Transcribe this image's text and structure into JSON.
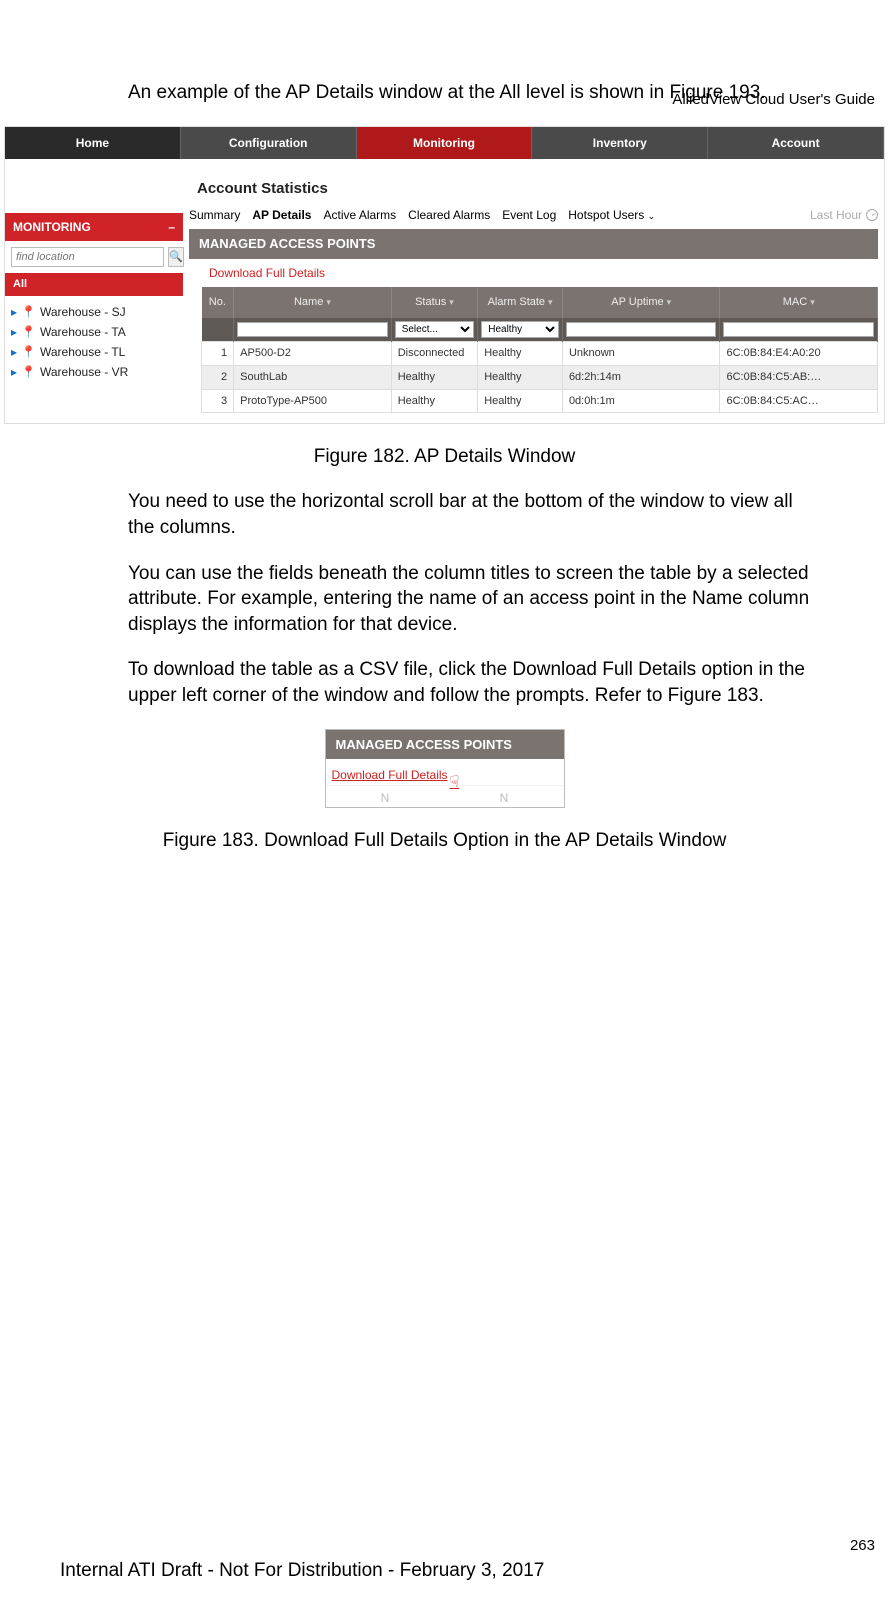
{
  "doc": {
    "header": "AlliedView Cloud User's Guide",
    "intro": "An example of the AP Details window at the All level is shown in Figure 193.",
    "caption1": "Figure 182. AP Details Window",
    "p2": "You need to use the horizontal scroll bar at the bottom of the window to view all the columns.",
    "p3": "You can use the fields beneath the column titles to screen the table by a selected attribute. For example, entering the name of an access point in the Name column displays the information for that device.",
    "p4": "To download the table as a CSV file, click the Download Full Details option in the upper left corner of the window and follow the prompts. Refer to Figure 183.",
    "caption2": "Figure 183. Download Full Details Option in the AP Details Window",
    "pagenum": "263",
    "footer": "Internal ATI Draft - Not For Distribution - February 3, 2017"
  },
  "nav": {
    "home": "Home",
    "config": "Configuration",
    "monitor": "Monitoring",
    "inventory": "Inventory",
    "account": "Account"
  },
  "page": {
    "title": "Account Statistics",
    "tabs": {
      "summary": "Summary",
      "apdetails": "AP Details",
      "active": "Active Alarms",
      "cleared": "Cleared Alarms",
      "eventlog": "Event Log",
      "hotspot": "Hotspot Users"
    },
    "lasthour": "Last Hour"
  },
  "sidebar": {
    "title": "MONITORING",
    "placeholder": "find location",
    "all": "All",
    "items": [
      "Warehouse - SJ",
      "Warehouse - TA",
      "Warehouse - TL",
      "Warehouse - VR"
    ]
  },
  "panel": {
    "title": "MANAGED ACCESS POINTS",
    "download": "Download Full Details"
  },
  "table": {
    "headers": {
      "no": "No.",
      "name": "Name",
      "status": "Status",
      "alarm": "Alarm State",
      "uptime": "AP Uptime",
      "mac": "MAC"
    },
    "filters": {
      "status": "Select...",
      "alarm": "Healthy"
    },
    "rows": [
      {
        "no": "1",
        "name": "AP500-D2",
        "status": "Disconnected",
        "alarm": "Healthy",
        "uptime": "Unknown",
        "mac": "6C:0B:84:E4:A0:20"
      },
      {
        "no": "2",
        "name": "SouthLab",
        "status": "Healthy",
        "alarm": "Healthy",
        "uptime": "6d:2h:14m",
        "mac": "6C:0B:84:C5:AB:…"
      },
      {
        "no": "3",
        "name": "ProtoType-AP500",
        "status": "Healthy",
        "alarm": "Healthy",
        "uptime": "0d:0h:1m",
        "mac": "6C:0B:84:C5:AC…"
      }
    ]
  },
  "shot2": {
    "partial": "N"
  }
}
